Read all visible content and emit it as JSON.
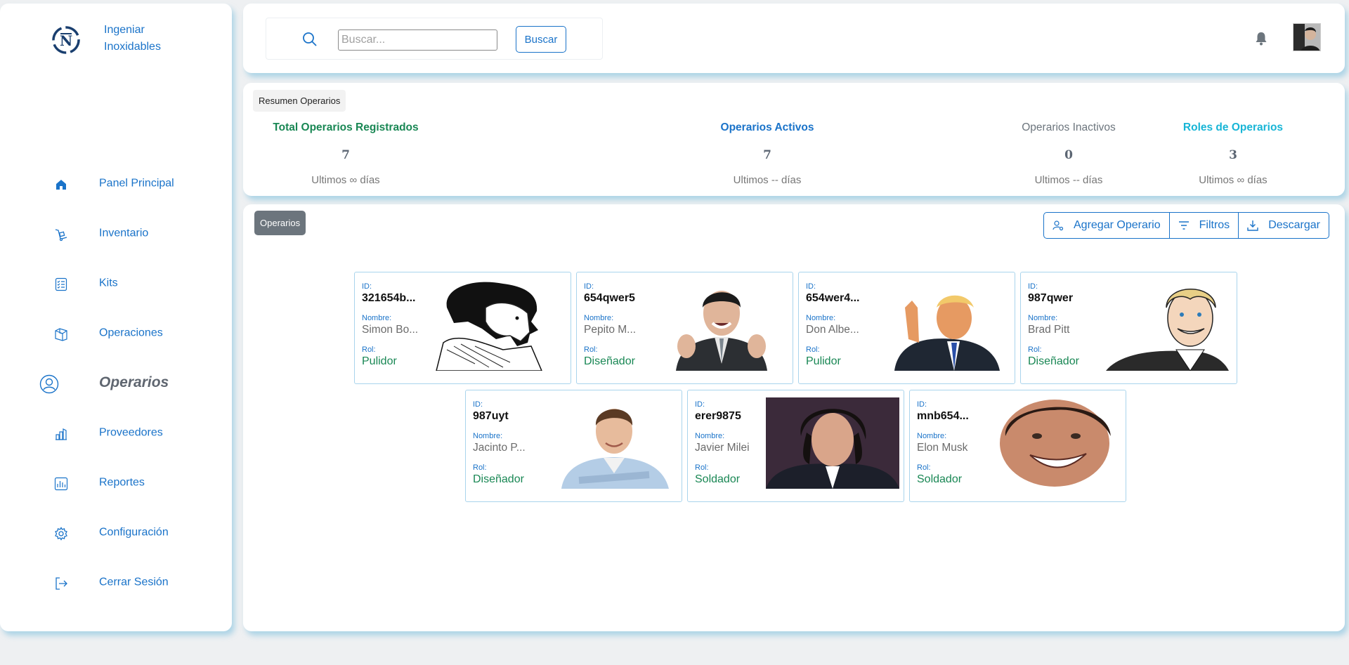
{
  "brand": {
    "name": "Ingeniar Inoxidables"
  },
  "sidebar": {
    "items": [
      {
        "label": "Panel Principal",
        "icon": "home-icon"
      },
      {
        "label": "Inventario",
        "icon": "inventory-icon"
      },
      {
        "label": "Kits",
        "icon": "checklist-icon"
      },
      {
        "label": "Operaciones",
        "icon": "operations-icon"
      },
      {
        "label": "Operarios",
        "icon": "user-circle-icon",
        "active": true
      },
      {
        "label": "Proveedores",
        "icon": "building-icon"
      },
      {
        "label": "Reportes",
        "icon": "bar-chart-icon"
      },
      {
        "label": "Configuración",
        "icon": "gear-icon"
      },
      {
        "label": "Cerrar Sesión",
        "icon": "logout-icon"
      }
    ]
  },
  "header": {
    "search_placeholder": "Buscar...",
    "search_button": "Buscar"
  },
  "summary": {
    "title": "Resumen Operarios",
    "stats": [
      {
        "title": "Total Operarios Registrados",
        "value": "7",
        "period": "Ultimos ∞ días",
        "color": "#198754"
      },
      {
        "title": "Operarios Activos",
        "value": "7",
        "period": "Ultimos -- días",
        "color": "#1a73c9"
      },
      {
        "title": "Operarios Inactivos",
        "value": "0",
        "period": "Ultimos -- días",
        "color": "#6c757d"
      },
      {
        "title": "Roles de Operarios",
        "value": "3",
        "period": "Ultimos ∞ días",
        "color": "#17b5d6"
      }
    ]
  },
  "main": {
    "tab_label": "Operarios",
    "toolbar": {
      "add": "Agregar Operario",
      "filters": "Filtros",
      "download": "Descargar"
    },
    "labels": {
      "id": "ID:",
      "name": "Nombre:",
      "role": "Rol:"
    },
    "operators": [
      {
        "id": "321654b...",
        "name": "Simon Bo...",
        "role": "Pulidor"
      },
      {
        "id": "654qwer5",
        "name": "Pepito M...",
        "role": "Diseñador"
      },
      {
        "id": "654wer4...",
        "name": "Don Albe...",
        "role": "Pulidor"
      },
      {
        "id": "987qwer",
        "name": "Brad Pitt",
        "role": "Diseñador"
      },
      {
        "id": "987uyt",
        "name": "Jacinto P...",
        "role": "Diseñador"
      },
      {
        "id": "erer9875",
        "name": "Javier Milei",
        "role": "Soldador"
      },
      {
        "id": "mnb654...",
        "name": "Elon Musk",
        "role": "Soldador"
      }
    ]
  },
  "colors": {
    "primary": "#1a73c9",
    "success": "#198754",
    "muted": "#6c757d",
    "info": "#17b5d6",
    "card_border": "#a9d4ec"
  }
}
